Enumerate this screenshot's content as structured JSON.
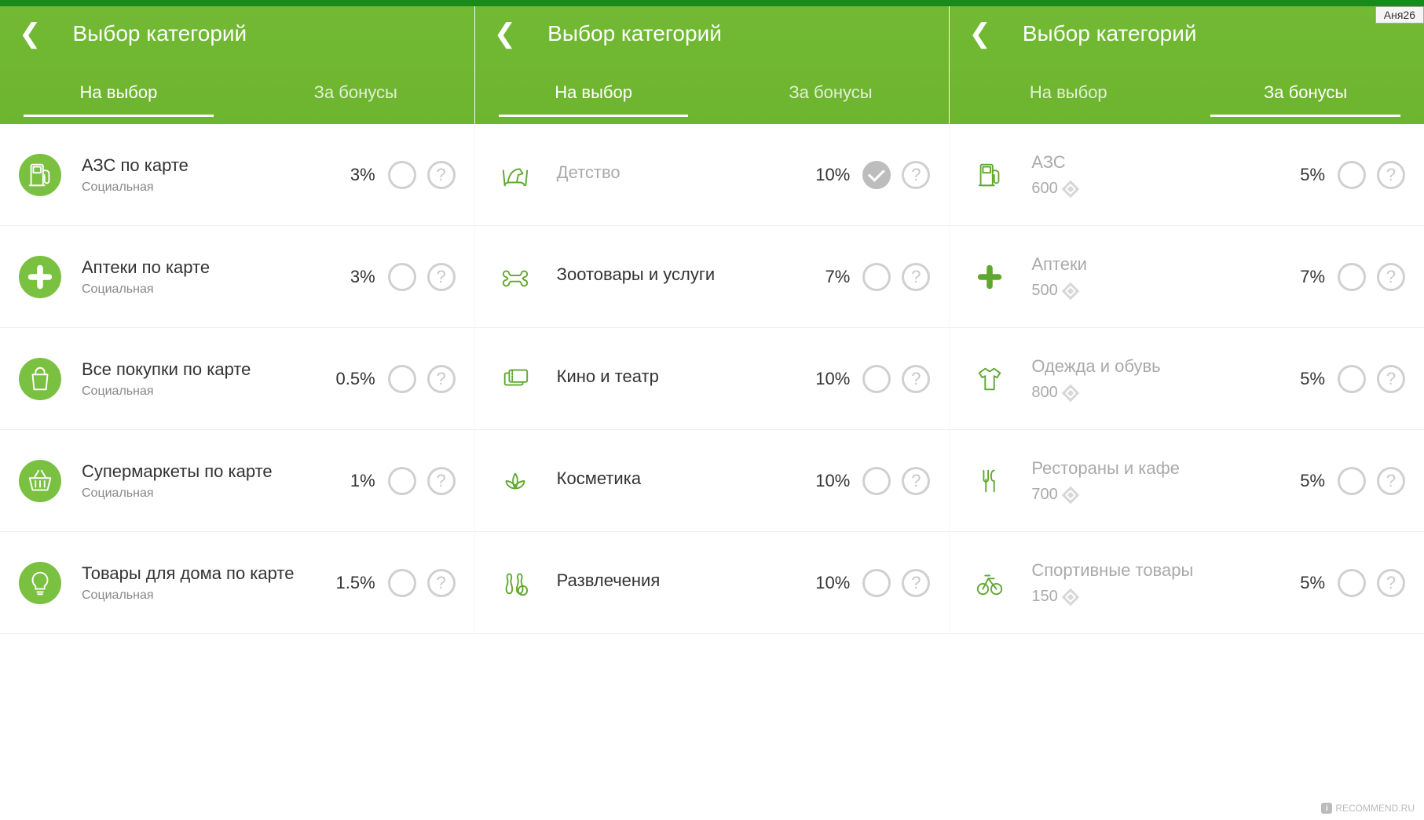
{
  "username_tag": "Аня26",
  "watermark": "RECOMMEND.RU",
  "panels": [
    {
      "title": "Выбор категорий",
      "tab_choice": "На выбор",
      "tab_bonus": "За бонусы",
      "active_tab": "choice",
      "items": [
        {
          "icon": "fuel",
          "style": "filled",
          "title": "АЗС по карте",
          "sub": "Социальная",
          "percent": "3%",
          "checked": false
        },
        {
          "icon": "pharmacy",
          "style": "filled",
          "title": "Аптеки по карте",
          "sub": "Социальная",
          "percent": "3%",
          "checked": false
        },
        {
          "icon": "bag",
          "style": "filled",
          "title": "Все покупки по карте",
          "sub": "Социальная",
          "percent": "0.5%",
          "checked": false
        },
        {
          "icon": "basket",
          "style": "filled",
          "title": "Супермаркеты по карте",
          "sub": "Социальная",
          "percent": "1%",
          "checked": false
        },
        {
          "icon": "lamp",
          "style": "filled",
          "title": "Товары для дома по карте",
          "sub": "Социальная",
          "percent": "1.5%",
          "checked": false
        }
      ]
    },
    {
      "title": "Выбор категорий",
      "tab_choice": "На выбор",
      "tab_bonus": "За бонусы",
      "active_tab": "choice",
      "items": [
        {
          "icon": "horse",
          "style": "outline",
          "title": "Детство",
          "muted": true,
          "percent": "10%",
          "checked": true
        },
        {
          "icon": "bone",
          "style": "outline",
          "title": "Зоотовары и услуги",
          "percent": "7%",
          "checked": false
        },
        {
          "icon": "tickets",
          "style": "outline",
          "title": "Кино и театр",
          "percent": "10%",
          "checked": false
        },
        {
          "icon": "lotus",
          "style": "outline",
          "title": "Косметика",
          "percent": "10%",
          "checked": false
        },
        {
          "icon": "bowling",
          "style": "outline",
          "title": "Развлечения",
          "percent": "10%",
          "checked": false
        }
      ]
    },
    {
      "title": "Выбор категорий",
      "tab_choice": "На выбор",
      "tab_bonus": "За бонусы",
      "active_tab": "bonus",
      "items": [
        {
          "icon": "fuel",
          "style": "outline",
          "title": "АЗС",
          "muted": true,
          "price": "600",
          "percent": "5%",
          "checked": false
        },
        {
          "icon": "pharmacy",
          "style": "outline",
          "title": "Аптеки",
          "muted": true,
          "price": "500",
          "percent": "7%",
          "checked": false
        },
        {
          "icon": "shirt",
          "style": "outline",
          "title": "Одежда и обувь",
          "muted": true,
          "price": "800",
          "percent": "5%",
          "checked": false
        },
        {
          "icon": "restaurant",
          "style": "outline",
          "title": "Рестораны и кафе",
          "muted": true,
          "price": "700",
          "percent": "5%",
          "checked": false
        },
        {
          "icon": "bike",
          "style": "outline",
          "title": "Спортивные товары",
          "muted": true,
          "price": "150",
          "percent": "5%",
          "checked": false
        }
      ]
    }
  ]
}
